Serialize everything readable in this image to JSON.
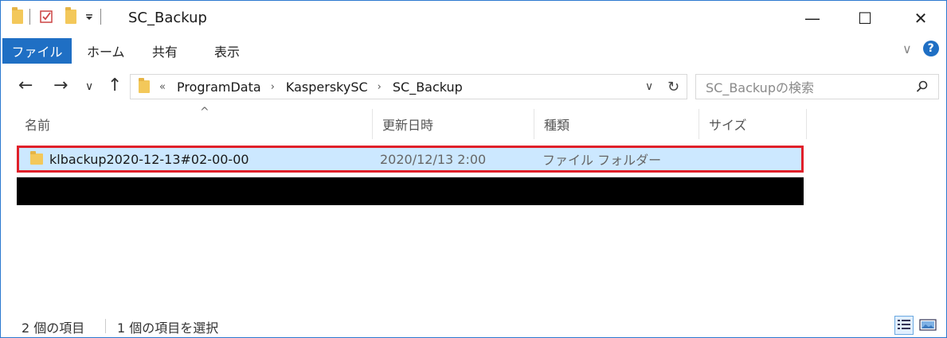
{
  "window": {
    "title": "SC_Backup",
    "minimize": "—",
    "maximize": "☐",
    "close": "✕"
  },
  "ribbon": {
    "file_tab": "ファイル",
    "tabs": [
      "ホーム",
      "共有",
      "表示"
    ],
    "expand": "∨",
    "help": "?"
  },
  "nav": {
    "back": "←",
    "forward": "→",
    "recent": "∨",
    "up": "↑",
    "overflow": "«",
    "path": [
      "ProgramData",
      "KasperskySC",
      "SC_Backup"
    ],
    "path_sep": "›",
    "dropdown": "∨",
    "refresh": "↻"
  },
  "search": {
    "placeholder": "SC_Backupの検索",
    "icon": "search-icon"
  },
  "columns": {
    "name": "名前",
    "date": "更新日時",
    "type": "種類",
    "size": "サイズ",
    "sort_indicator": "^"
  },
  "files": [
    {
      "name": "klbackup2020-12-13#02-00-00",
      "date": "2020/12/13 2:00",
      "type": "ファイル フォルダー",
      "selected": true,
      "highlight_color": "#e0202a"
    }
  ],
  "status": {
    "count": "2 個の項目",
    "selected": "1 個の項目を選択"
  },
  "colors": {
    "accent": "#1f6fc4",
    "selection": "#cce8ff",
    "folder": "#f3c85a"
  }
}
